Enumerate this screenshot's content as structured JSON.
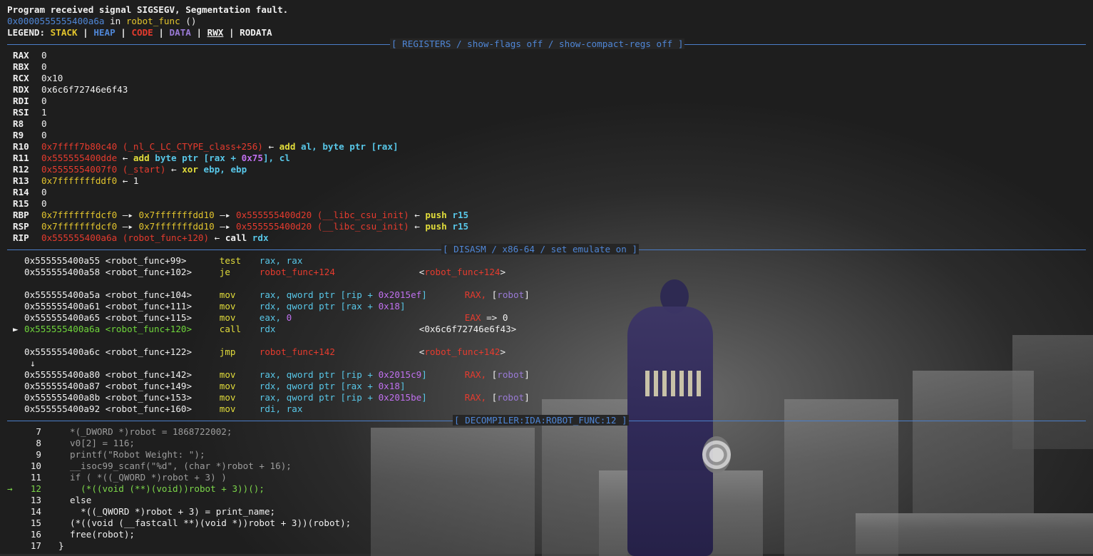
{
  "header": {
    "signal_msg": "Program received signal SIGSEGV, Segmentation fault.",
    "location_addr": "0x0000555555400a6a",
    "location_in": " in ",
    "location_func": "robot_func",
    "location_args": " ()",
    "legend_label": "LEGEND: ",
    "legend_stack": "STACK",
    "legend_heap": "HEAP",
    "legend_code": "CODE",
    "legend_data": "DATA",
    "legend_rwx": "RWX",
    "legend_rodata": "RODATA",
    "legend_sep": " | "
  },
  "sections": {
    "registers_title": "[ REGISTERS / show-flags off / show-compact-regs off ]",
    "disasm_title": "[ DISASM / x86-64 / set emulate on ]",
    "decompiler_title": "[ DECOMPILER:IDA:ROBOT_FUNC:12 ]"
  },
  "registers": {
    "rax": {
      "name": "RAX",
      "value": "0"
    },
    "rbx": {
      "name": "RBX",
      "value": "0"
    },
    "rcx": {
      "name": "RCX",
      "value": "0x10"
    },
    "rdx": {
      "name": "RDX",
      "value": "0x6c6f72746e6f43"
    },
    "rdi": {
      "name": "RDI",
      "value": "0"
    },
    "rsi": {
      "name": "RSI",
      "value": "1"
    },
    "r8": {
      "name": "R8",
      "value": "0"
    },
    "r9": {
      "name": "R9",
      "value": "0"
    },
    "r10": {
      "name": "R10",
      "value": "0x7ffff7b80c40",
      "sym": "(_nl_C_LC_CTYPE_class+256)",
      "arrow": " ←",
      "ins_mn": "add",
      "ins_a": "al",
      "ins_b": "byte ptr",
      "ins_c": "[rax]"
    },
    "r11": {
      "name": "R11",
      "value": "0x555555400dde",
      "arrow": " ←",
      "ins_mn": "add",
      "ins_a": "byte ptr",
      "ins_b": "[rax + ",
      "ins_num": "0x75",
      "ins_c": "], cl"
    },
    "r12": {
      "name": "R12",
      "value": "0x5555554007f0",
      "sym": "(_start)",
      "arrow": " ←",
      "ins_mn": "xor",
      "ins_a": "ebp, ebp"
    },
    "r13": {
      "name": "R13",
      "value": "0x7fffffffddf0",
      "arrow": " ←",
      "tail": "1"
    },
    "r14": {
      "name": "R14",
      "value": "0"
    },
    "r15": {
      "name": "R15",
      "value": "0"
    },
    "rbp": {
      "name": "RBP",
      "value": "0x7fffffffdcf0",
      "arrow1": " —▸ ",
      "v2": "0x7fffffffdd10",
      "arrow2": " —▸ ",
      "v3": "0x555555400d20",
      "sym": "(__libc_csu_init)",
      "arrow": " ←",
      "ins_mn": "push",
      "ins_a": "r15"
    },
    "rsp": {
      "name": "RSP",
      "value": "0x7fffffffdcf0",
      "arrow1": " —▸ ",
      "v2": "0x7fffffffdd10",
      "arrow2": " —▸ ",
      "v3": "0x555555400d20",
      "sym": "(__libc_csu_init)",
      "arrow": " ←",
      "ins_mn": "push",
      "ins_a": "r15"
    },
    "rip": {
      "name": "RIP",
      "value": "0x555555400a6a",
      "sym": "(robot_func+120)",
      "arrow": " ←",
      "ins_mn": "call",
      "ins_a": "rdx"
    }
  },
  "disasm": [
    {
      "addr": "0x555555400a55",
      "sym": "<robot_func+99>",
      "mn": "test",
      "ops": "rax, rax",
      "extra": ""
    },
    {
      "addr": "0x555555400a58",
      "sym": "<robot_func+102>",
      "mn": "je",
      "target": "robot_func+124",
      "extra_open": "<",
      "extra_sym": "robot_func+124",
      "extra_close": ">"
    },
    {
      "addr": "0x555555400a5a",
      "sym": "<robot_func+104>",
      "mn": "mov",
      "ops_a": "rax, ",
      "ops_b": "qword ptr",
      "ops_c": " [rip + ",
      "ops_num": "0x2015ef",
      "ops_d": "]",
      "c1": "RAX, ",
      "c2": "[",
      "c3": "robot",
      "c4": "]"
    },
    {
      "addr": "0x555555400a61",
      "sym": "<robot_func+111>",
      "mn": "mov",
      "ops_a": "rdx, ",
      "ops_b": "qword ptr",
      "ops_c": " [rax + ",
      "ops_num": "0x18",
      "ops_d": "]"
    },
    {
      "addr": "0x555555400a65",
      "sym": "<robot_func+115>",
      "mn": "mov",
      "ops_a": "eax, ",
      "ops_num": "0",
      "c1": "EAX",
      "c5": " => 0"
    },
    {
      "marker": "►",
      "addr": "0x555555400a6a",
      "sym": "<robot_func+120>",
      "mn": "call",
      "ops_a": "rdx",
      "extra": "<0x6c6f72746e6f43>"
    },
    {
      "addr": "0x555555400a6c",
      "sym": "<robot_func+122>",
      "mn": "jmp",
      "target": "robot_func+142",
      "extra_open": "<",
      "extra_sym": "robot_func+142",
      "extra_close": ">"
    },
    {
      "down_arrow": "↓"
    },
    {
      "addr": "0x555555400a80",
      "sym": "<robot_func+142>",
      "mn": "mov",
      "ops_a": "rax, ",
      "ops_b": "qword ptr",
      "ops_c": " [rip + ",
      "ops_num": "0x2015c9",
      "ops_d": "]",
      "c1": "RAX, ",
      "c2": "[",
      "c3": "robot",
      "c4": "]"
    },
    {
      "addr": "0x555555400a87",
      "sym": "<robot_func+149>",
      "mn": "mov",
      "ops_a": "rdx, ",
      "ops_b": "qword ptr",
      "ops_c": " [rax + ",
      "ops_num": "0x18",
      "ops_d": "]"
    },
    {
      "addr": "0x555555400a8b",
      "sym": "<robot_func+153>",
      "mn": "mov",
      "ops_a": "rax, ",
      "ops_b": "qword ptr",
      "ops_c": " [rip + ",
      "ops_num": "0x2015be",
      "ops_d": "]",
      "c1": "RAX, ",
      "c2": "[",
      "c3": "robot",
      "c4": "]"
    },
    {
      "addr": "0x555555400a92",
      "sym": "<robot_func+160>",
      "mn": "mov",
      "ops_a": "rdi, rax"
    }
  ],
  "decompiler": [
    {
      "num": "7",
      "code": "*(_DWORD *)robot = 1868722002;"
    },
    {
      "num": "8",
      "code": "v0[2] = 116;"
    },
    {
      "num": "9",
      "code": "printf(\"Robot Weight: \");"
    },
    {
      "num": "10",
      "code": "__isoc99_scanf(\"%d\", (char *)robot + 16);"
    },
    {
      "num": "11",
      "code": "if ( *((_QWORD *)robot + 3) )"
    },
    {
      "num": "12",
      "code": "  (*((void (**)(void))robot + 3))();",
      "marker": "→"
    },
    {
      "num": "13",
      "code": "else"
    },
    {
      "num": "14",
      "code": "  *((_QWORD *)robot + 3) = print_name;"
    },
    {
      "num": "15",
      "code": "(*((void (__fastcall **)(void *))robot + 3))(robot);"
    },
    {
      "num": "16",
      "code": "free(robot);"
    },
    {
      "num": "17",
      "code": "}"
    }
  ]
}
